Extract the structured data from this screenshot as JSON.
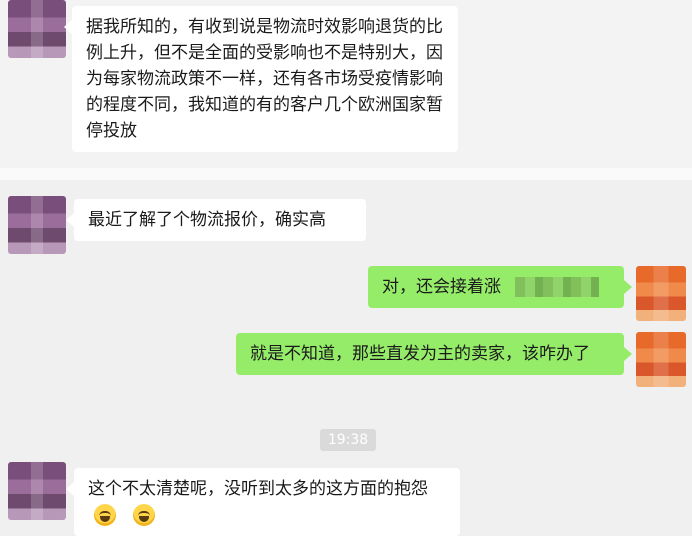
{
  "messages": [
    {
      "side": "left",
      "text": "据我所知的，有收到说是物流时效影响退货的比例上升，但不是全面的受影响也不是特别大，因为每家物流政策不一样，还有各市场受疫情影响的程度不同，我知道的有的客户几个欧洲国家暂停投放"
    },
    {
      "side": "left",
      "text": "最近了解了个物流报价，确实高"
    },
    {
      "side": "right",
      "text": "对，还会接着涨"
    },
    {
      "side": "right",
      "text": "就是不知道，那些直发为主的卖家，该咋办了"
    },
    {
      "side": "left",
      "text": "这个不太清楚呢，没听到太多的这方面的抱怨"
    }
  ],
  "timestamp": "19:38",
  "colors": {
    "sent_bubble": "#95ec69",
    "received_bubble": "#ffffff",
    "background": "#f0f0f0"
  },
  "icons": {
    "emoji": "tears-of-joy-emoji"
  }
}
